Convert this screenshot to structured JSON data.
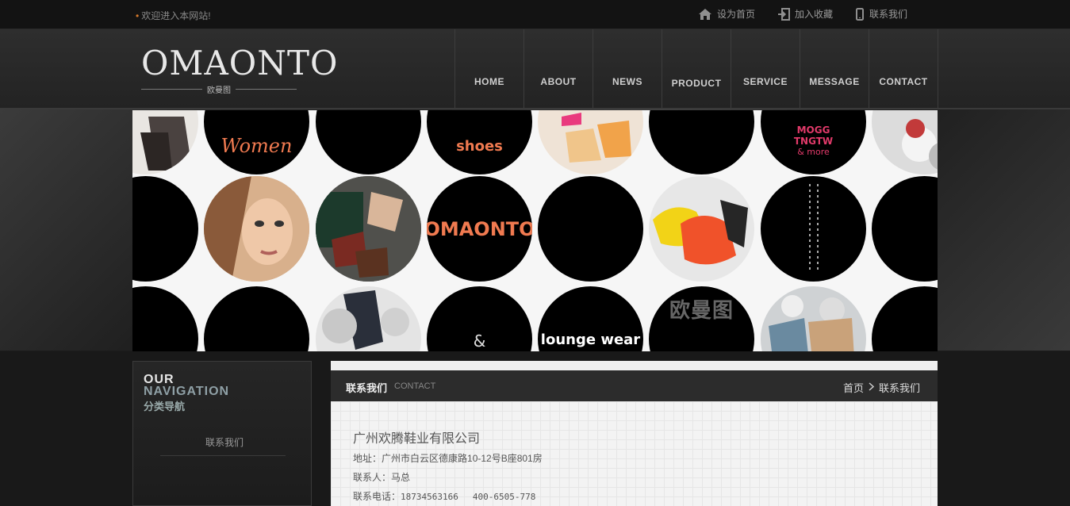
{
  "topbar": {
    "welcome": "欢迎进入本网站!",
    "links": [
      {
        "label": "设为首页",
        "icon": "home-icon"
      },
      {
        "label": "加入收藏",
        "icon": "login-icon"
      },
      {
        "label": "联系我们",
        "icon": "phone-icon"
      }
    ]
  },
  "header": {
    "logo_text": "OMAONTO",
    "logo_sub": "欧曼图",
    "nav": [
      "HOME",
      "ABOUT",
      "NEWS",
      "PRODUCT",
      "SERVICE",
      "MESSAGE",
      "CONTACT"
    ]
  },
  "banner": {
    "words": [
      "Women",
      "shoes",
      "MOGG",
      "TNGTW",
      "& more",
      "OMAONTO",
      "&",
      "lounge wear",
      "欧曼图"
    ]
  },
  "sidebar": {
    "our": "OUR",
    "navigation": "NAVIGATION",
    "cn_title": "分类导航",
    "items": [
      "联系我们"
    ]
  },
  "content": {
    "title_cn": "联系我们",
    "title_en": "CONTACT",
    "breadcrumb": [
      "首页",
      "联系我们"
    ],
    "company": "广州欢腾鞋业有限公司",
    "address_label": "地址：",
    "address": "广州市白云区德康路10-12号B座801房",
    "contact_label": "联系人：",
    "contact": "马总",
    "phone_label": "联系电话：",
    "phone1": "18734563166",
    "phone2": "400-6505-778"
  },
  "colors": {
    "accent": "#d97a2b",
    "banner_orange": "#f07a50",
    "banner_pink": "#e23a6a"
  }
}
